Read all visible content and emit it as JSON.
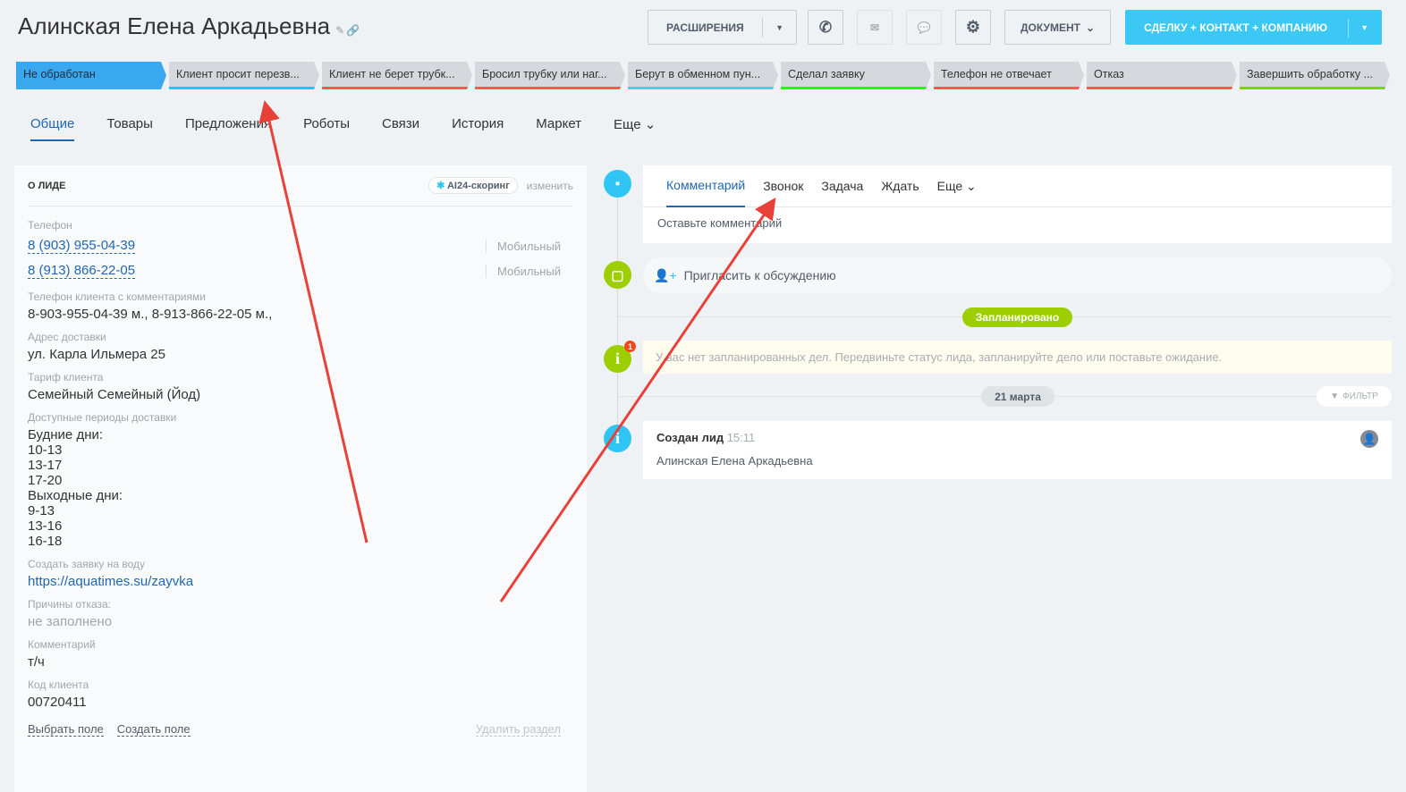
{
  "header": {
    "title": "Алинская Елена  Аркадьевна",
    "extensions_label": "РАСШИРЕНИЯ",
    "document_label": "ДОКУМЕНТ",
    "convert_label": "СДЕЛКУ + КОНТАКТ + КОМПАНИЮ",
    "accent": "#3bc8f5"
  },
  "stages": [
    {
      "label": "Не обработан",
      "color": "#39a8ef"
    },
    {
      "label": "Клиент просит перезв...",
      "color": "#1ec5f5"
    },
    {
      "label": "Клиент не берет трубк...",
      "color": "#ff5752"
    },
    {
      "label": "Бросил трубку или наг...",
      "color": "#ff5752"
    },
    {
      "label": "Берут в обменном пун...",
      "color": "#47d1e2"
    },
    {
      "label": "Сделал заявку",
      "color": "#1eff00"
    },
    {
      "label": "Телефон не отвечает",
      "color": "#ff5752"
    },
    {
      "label": "Отказ",
      "color": "#ff5752"
    },
    {
      "label": "Завершить обработку ...",
      "color": "#7bd500"
    }
  ],
  "tabs": [
    "Общие",
    "Товары",
    "Предложения",
    "Роботы",
    "Связи",
    "История",
    "Маркет",
    "Еще"
  ],
  "lead": {
    "section_title": "О ЛИДЕ",
    "ai_badge": "AI24-скоринг",
    "edit_label": "изменить",
    "phone_label": "Телефон",
    "phones": [
      {
        "number": "8 (903) 955-04-39",
        "type": "Мобильный"
      },
      {
        "number": "8 (913) 866-22-05",
        "type": "Мобильный"
      }
    ],
    "fields": [
      {
        "label": "Телефон клиента с комментариями",
        "value": "8-903-955-04-39 м., 8-913-866-22-05 м.,"
      },
      {
        "label": "Адрес доставки",
        "value": "ул. Карла Ильмера 25"
      },
      {
        "label": "Тариф клиента",
        "value": "Семейный Семейный (Йод)"
      }
    ],
    "periods_label": "Доступные периоды доставки",
    "periods": [
      "Будние дни:",
      "10-13",
      "13-17",
      "17-20",
      "Выходные дни:",
      "9-13",
      "13-16",
      "16-18"
    ],
    "order_label": "Создать заявку на воду",
    "order_link": "https://aquatimes.su/zayvka",
    "reject_label": "Причины отказа:",
    "reject_value": "не заполнено",
    "comment_label": "Комментарий",
    "comment_value": "т/ч",
    "code_label": "Код клиента",
    "code_value": "00720411",
    "select_field": "Выбрать поле",
    "create_field": "Создать поле",
    "delete_section": "Удалить раздел"
  },
  "timeline": {
    "tabs": [
      "Комментарий",
      "Звонок",
      "Задача",
      "Ждать",
      "Еще"
    ],
    "comment_placeholder": "Оставьте комментарий",
    "invite": "Пригласить к обсуждению",
    "planned_badge": "Запланировано",
    "notice_count": "1",
    "notice": "У вас нет запланированных дел. Передвиньте статус лида, запланируйте дело или поставьте ожидание.",
    "date_badge": "21 марта",
    "filter": "ФИЛЬТР",
    "event_title": "Создан лид",
    "event_time": "15:11",
    "event_body": "Алинская Елена Аркадьевна"
  }
}
